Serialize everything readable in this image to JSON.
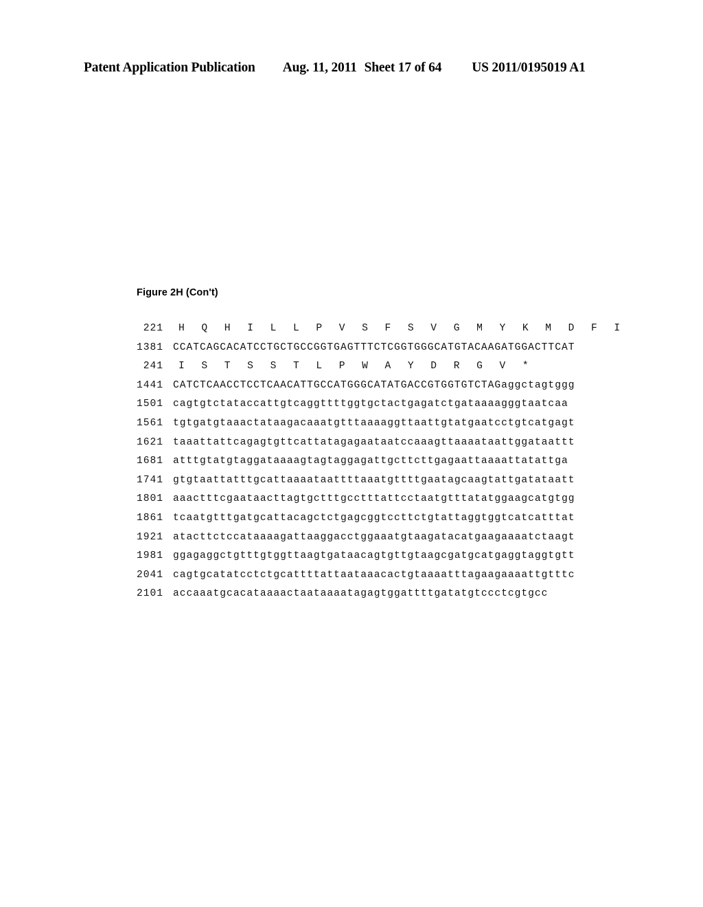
{
  "header": {
    "publication": "Patent Application Publication",
    "date": "Aug. 11, 2011",
    "sheet": "Sheet 17 of 64",
    "number": "US 2011/0195019 A1"
  },
  "figure": {
    "caption": "Figure 2H (Con't)"
  },
  "sequence": {
    "rows": [
      {
        "num": "221",
        "type": "protein",
        "residues": [
          "H",
          "Q",
          "H",
          "I",
          "L",
          "L",
          "P",
          "V",
          "S",
          "F",
          "S",
          "V",
          "G",
          "M",
          "Y",
          "K",
          "M",
          "D",
          "F",
          "I"
        ],
        "text": "H  Q  H  I  L  L  P  V  S  F  S  V  G  M  Y  K  M  D  F  I"
      },
      {
        "num": "1381",
        "type": "dna",
        "text": "CCATCAGCACATCCTGCTGCCGGTGAGTTTCTCGGTGGGCATGTACAAGATGGACTTCAT"
      },
      {
        "num": "241",
        "type": "protein",
        "residues": [
          "I",
          "S",
          "T",
          "S",
          "S",
          "T",
          "L",
          "P",
          "W",
          "A",
          "Y",
          "D",
          "R",
          "G",
          "V",
          "*"
        ],
        "text": "I  S  T  S  S  T  L  P  W  A  Y  D  R  G  V  *"
      },
      {
        "num": "1441",
        "type": "dna",
        "text": "CATCTCAACCTCCTCAACATTGCCATGGGCATATGACCGTGGTGTCTAGaggctagtggg"
      },
      {
        "num": "1501",
        "type": "dna",
        "text": "cagtgtctataccattgtcaggttttggtgctactgagatctgataaaagggtaatcaa"
      },
      {
        "num": "1561",
        "type": "dna",
        "text": "tgtgatgtaaactataagacaaatgtttaaaaggttaattgtatgaatcctgtcatgagt"
      },
      {
        "num": "1621",
        "type": "dna",
        "text": "taaattattcagagtgttcattatagagaataatccaaagttaaaataattggataattt"
      },
      {
        "num": "1681",
        "type": "dna",
        "text": "atttgtatgtaggataaaagtagtaggagattgcttcttgagaattaaaattatattga"
      },
      {
        "num": "1741",
        "type": "dna",
        "text": "gtgtaattatttgcattaaaataattttaaatgttttgaatagcaagtattgatataatt"
      },
      {
        "num": "1801",
        "type": "dna",
        "text": "aaactttcgaataacttagtgctttgcctttattcctaatgtttatatggaagcatgtgg"
      },
      {
        "num": "1861",
        "type": "dna",
        "text": "tcaatgtttgatgcattacagctctgagcggtccttctgtattaggtggtcatcatttat"
      },
      {
        "num": "1921",
        "type": "dna",
        "text": "atacttctccataaaagattaaggacctggaaatgtaagatacatgaagaaaatctaagt"
      },
      {
        "num": "1981",
        "type": "dna",
        "text": "ggagaggctgtttgtggttaagtgataacagtgttgtaagcgatgcatgaggtaggtgtt"
      },
      {
        "num": "2041",
        "type": "dna",
        "text": "cagtgcatatcctctgcattttattaataaacactgtaaaatttagaagaaaattgtttc"
      },
      {
        "num": "2101",
        "type": "dna",
        "text": "accaaatgcacataaaactaataaaatagagtggattttgatatgtccctcgtgcc"
      }
    ]
  }
}
